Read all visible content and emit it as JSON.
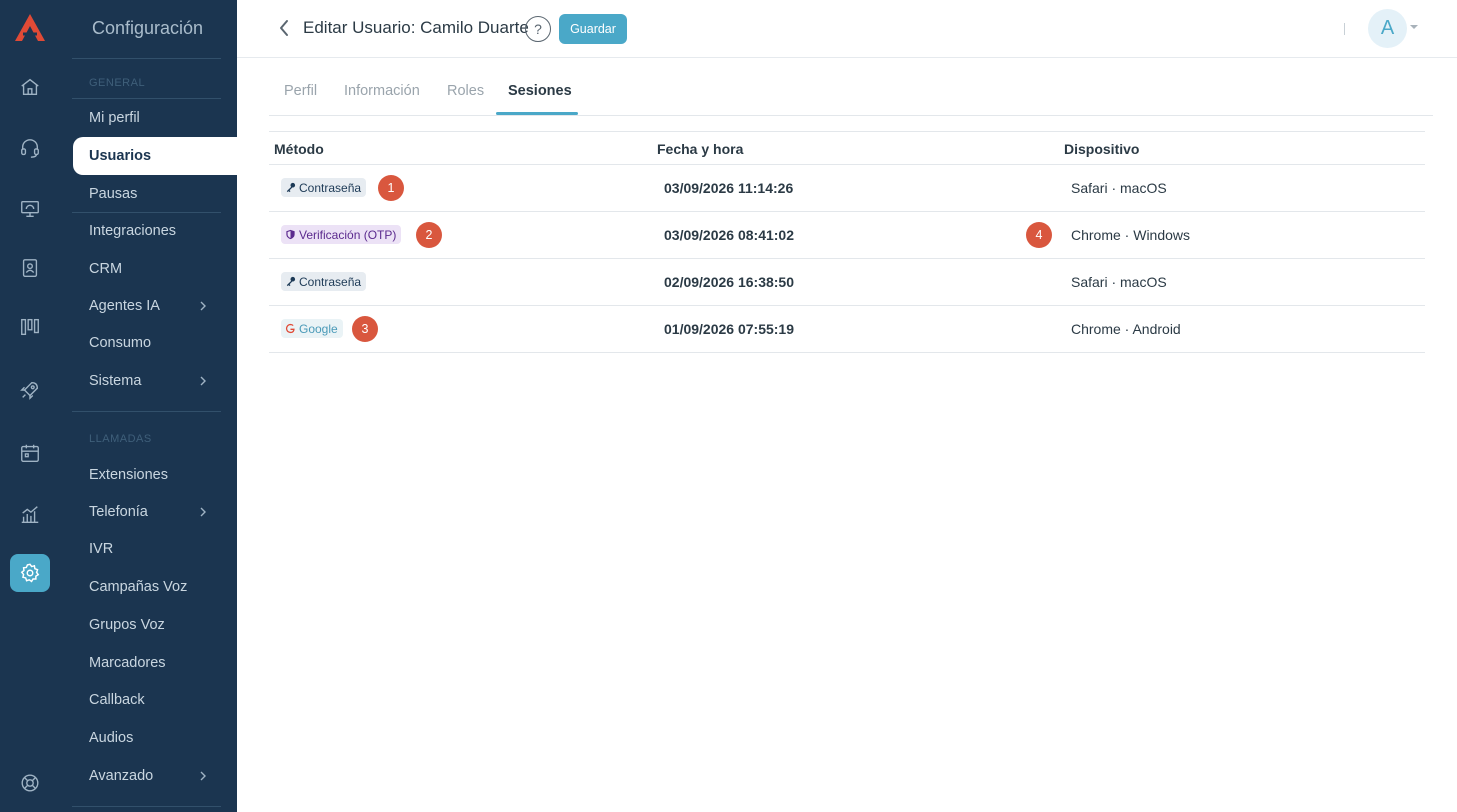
{
  "colors": {
    "sidebar_bg": "#1b3550",
    "accent": "#4aa8c8",
    "marker": "#d9573e",
    "logo": "#e04a36"
  },
  "rail": {
    "icons": [
      "logo-icon",
      "home-icon",
      "headset-icon",
      "monitor-icon",
      "contacts-icon",
      "columns-icon",
      "rocket-icon",
      "calendar-icon",
      "analytics-icon",
      "settings-icon",
      "support-icon"
    ]
  },
  "sidebar": {
    "title": "Configuración",
    "section_general": "GENERAL",
    "section_calls": "LLAMADAS",
    "items": [
      {
        "label": "Mi perfil"
      },
      {
        "label": "Usuarios"
      },
      {
        "label": "Pausas"
      },
      {
        "label": "Integraciones"
      },
      {
        "label": "CRM"
      },
      {
        "label": "Agentes IA"
      },
      {
        "label": "Consumo"
      },
      {
        "label": "Sistema"
      },
      {
        "label": "Extensiones"
      },
      {
        "label": "Telefonía"
      },
      {
        "label": "IVR"
      },
      {
        "label": "Campañas Voz"
      },
      {
        "label": "Grupos Voz"
      },
      {
        "label": "Marcadores"
      },
      {
        "label": "Callback"
      },
      {
        "label": "Audios"
      },
      {
        "label": "Avanzado"
      }
    ]
  },
  "header": {
    "title": "Editar Usuario: Camilo Duarte",
    "help": "?",
    "save_label": "Guardar",
    "avatar_initial": "A"
  },
  "tabs": [
    {
      "label": "Perfil"
    },
    {
      "label": "Información"
    },
    {
      "label": "Roles"
    },
    {
      "label": "Sesiones"
    }
  ],
  "table": {
    "headers": [
      "Método",
      "Fecha y hora",
      "Dispositivo"
    ],
    "rows": [
      {
        "method": "Contraseña",
        "datetime": "03/09/2026 11:14:26",
        "device": "Safari · macOS",
        "marker": "1"
      },
      {
        "method": "Verificación (OTP)",
        "datetime": "03/09/2026 08:41:02",
        "device": "Chrome · Windows",
        "marker": "2",
        "marker_device": "4"
      },
      {
        "method": "Contraseña",
        "datetime": "02/09/2026 16:38:50",
        "device": "Safari · macOS"
      },
      {
        "method": "Google",
        "datetime": "01/09/2026 07:55:19",
        "device": "Chrome · Android",
        "marker": "3"
      }
    ]
  }
}
